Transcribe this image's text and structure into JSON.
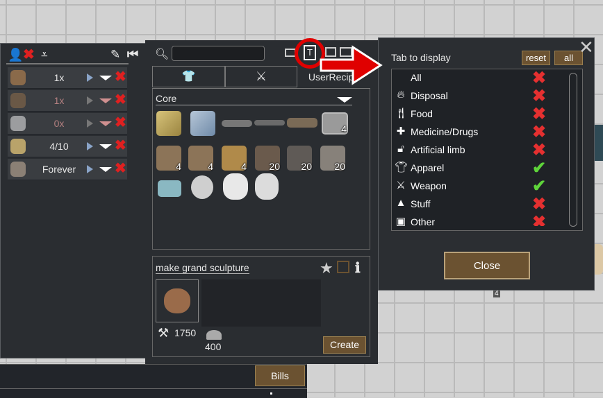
{
  "bills_panel": {
    "rows": [
      {
        "count": "1x",
        "icon": "sculpture-icon",
        "faded": false
      },
      {
        "count": "1x",
        "icon": "sculpture-icon",
        "faded": true
      },
      {
        "count": "0x",
        "icon": "fox-icon",
        "faded": true
      },
      {
        "count": "4/10",
        "icon": "gold-icon",
        "faded": false
      },
      {
        "count": "Forever",
        "icon": "stone-icon",
        "faded": false
      }
    ],
    "bills_button": "Bills"
  },
  "recipe_panel": {
    "search_value": "",
    "tabs": [
      {
        "name": "apparel-tab",
        "label": ""
      },
      {
        "name": "weapon-tab",
        "label": ""
      },
      {
        "name": "userrecipe-tab",
        "label": "UserRecipe"
      }
    ],
    "filter_mode_letter": "T",
    "category": "Core",
    "item_counts": [
      "4",
      "4",
      "4",
      "4",
      "20",
      "20",
      "20"
    ],
    "selected_title": "make grand sculpture",
    "work_amount": "1750",
    "material_amount": "400",
    "create_button": "Create"
  },
  "tab_dialog": {
    "title": "Tab to display",
    "reset_label": "reset",
    "all_label": "all",
    "rows": [
      {
        "label": "All",
        "icon": "none",
        "enabled": false
      },
      {
        "label": "Disposal",
        "icon": "flame-icon",
        "enabled": false
      },
      {
        "label": "Food",
        "icon": "fork-knife-icon",
        "enabled": false
      },
      {
        "label": "Medicine/Drugs",
        "icon": "medkit-icon",
        "enabled": false
      },
      {
        "label": "Artificial limb",
        "icon": "limb-icon",
        "enabled": false
      },
      {
        "label": "Apparel",
        "icon": "shirt-icon",
        "enabled": true
      },
      {
        "label": "Weapon",
        "icon": "swords-icon",
        "enabled": true
      },
      {
        "label": "Stuff",
        "icon": "stuff-icon",
        "enabled": false
      },
      {
        "label": "Other",
        "icon": "other-icon",
        "enabled": false
      }
    ],
    "close_label": "Close"
  },
  "stack_count_label": "4",
  "colors": {
    "highlight_red": "#e00000",
    "panel_bg": "#2a2d31",
    "brown_button": "#6b5231"
  }
}
